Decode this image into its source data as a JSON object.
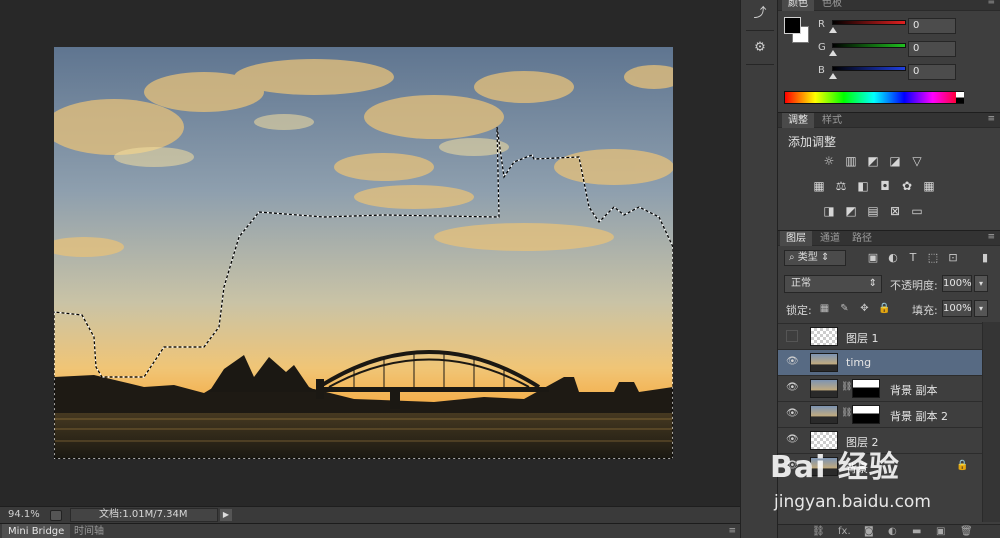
{
  "statusbar": {
    "zoom": "94.1%",
    "doc_info": "文档:1.01M/7.34M"
  },
  "bottom_tabs": [
    "Mini Bridge",
    "时间轴"
  ],
  "color_panel": {
    "tabs": [
      "颜色",
      "色板"
    ],
    "channels": [
      {
        "label": "R",
        "value": "0",
        "color": "#e02020"
      },
      {
        "label": "G",
        "value": "0",
        "color": "#20c020"
      },
      {
        "label": "B",
        "value": "0",
        "color": "#2040e0"
      }
    ],
    "foreground": "#000000",
    "background": "#ffffff"
  },
  "adjust_panel": {
    "tabs": [
      "调整",
      "样式"
    ],
    "title": "添加调整"
  },
  "layers_panel": {
    "tabs": [
      "图层",
      "通道",
      "路径"
    ],
    "filter_kind": "类型",
    "blend_mode": "正常",
    "opacity_label": "不透明度:",
    "opacity_value": "100%",
    "lock_label": "锁定:",
    "fill_label": "填充:",
    "fill_value": "100%",
    "layers": [
      {
        "name": "图层 1",
        "visible": false,
        "selected": false
      },
      {
        "name": "timg",
        "visible": true,
        "selected": true
      },
      {
        "name": "背景 副本",
        "visible": true,
        "selected": false
      },
      {
        "name": "背景 副本 2",
        "visible": true,
        "selected": false
      },
      {
        "name": "图层 2",
        "visible": true,
        "selected": false
      },
      {
        "name": "背景",
        "visible": true,
        "selected": false
      }
    ]
  },
  "watermark": {
    "logo": "Bai 经验",
    "url": "jingyan.baidu.com"
  }
}
